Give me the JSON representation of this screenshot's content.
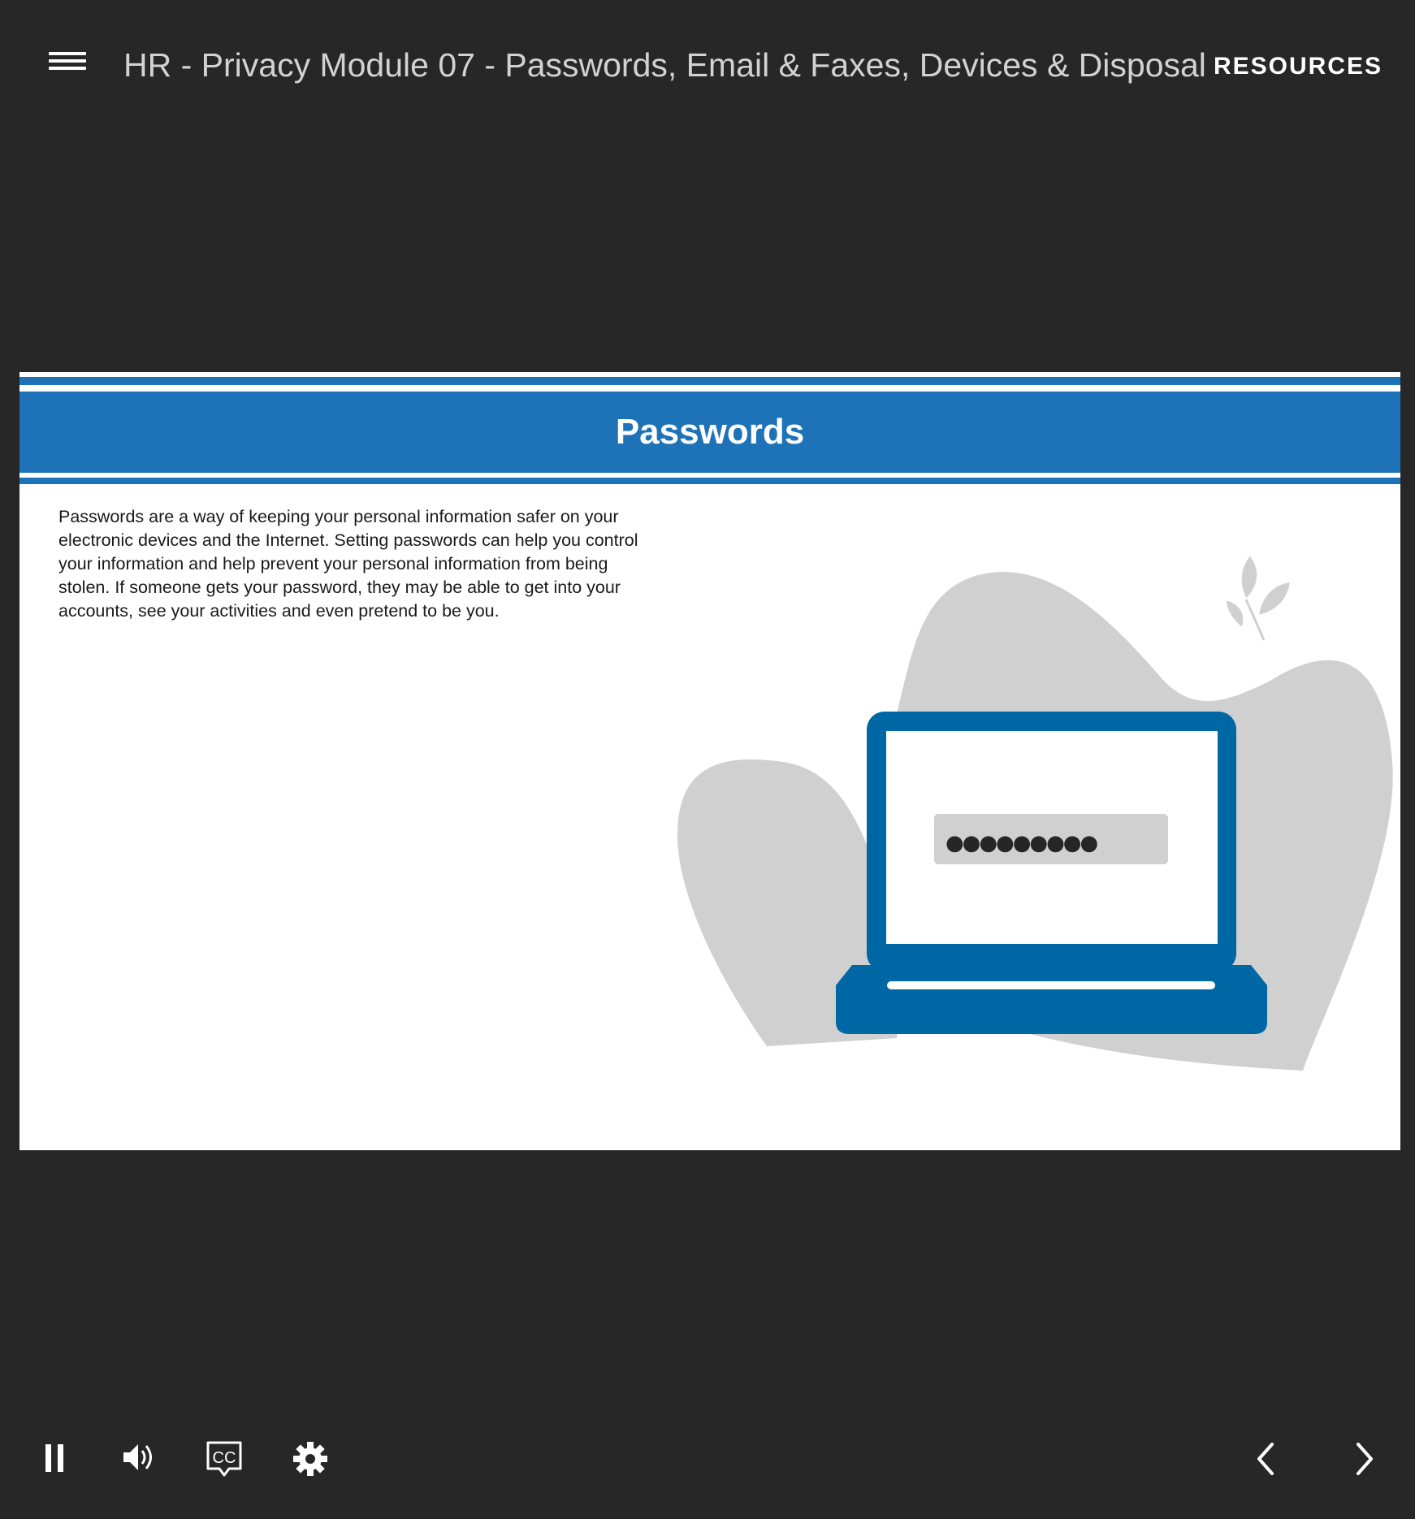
{
  "header": {
    "menu_icon": "hamburger-menu-icon",
    "course_title": "HR - Privacy Module 07 - Passwords, Email & Faxes, Devices & Disposal",
    "resources_label": "RESOURCES"
  },
  "slide": {
    "title": "Passwords",
    "body": "Passwords are a way of keeping your personal information safer on your electronic devices and the Internet. Setting passwords can help you control your information and help prevent your personal information from being stolen. If someone gets your password, they may be able to get into your accounts, see your activities and even pretend to be you.",
    "password_dots": "●●●●●●●●●",
    "colors": {
      "band": "#1e73b8",
      "laptop": "#0067a5",
      "blob": "#d0d0d0",
      "background": "#272727"
    }
  },
  "controls": {
    "pause_icon": "pause-icon",
    "volume_icon": "volume-icon",
    "captions_icon": "closed-captions-icon",
    "captions_label": "CC",
    "settings_icon": "gear-icon",
    "prev_icon": "chevron-left-icon",
    "next_icon": "chevron-right-icon"
  }
}
